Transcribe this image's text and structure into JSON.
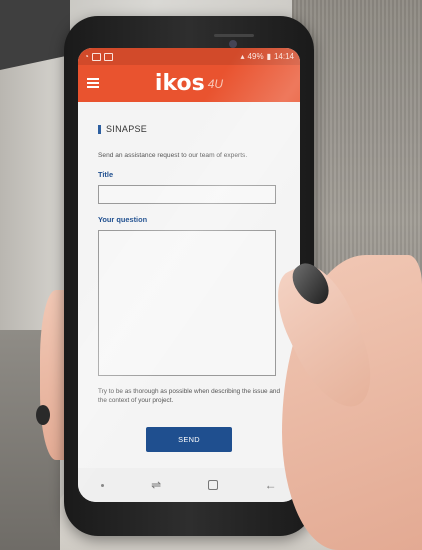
{
  "statusbar": {
    "battery": "49%",
    "time": "14:14"
  },
  "appbar": {
    "logo": "ikos",
    "logo_suffix": "4U"
  },
  "form": {
    "section_title": "SINAPSE",
    "intro": "Send an assistance request to our team of experts.",
    "title_label": "Title",
    "title_value": "",
    "question_label": "Your question",
    "question_value": "",
    "hint": "Try to be as thorough as possible when describing the issue and the context of your project.",
    "send_label": "SEND"
  },
  "navbar": {
    "recent_icon": "recent-apps-icon",
    "home_icon": "home-icon",
    "back_icon": "back-icon"
  },
  "colors": {
    "accent": "#e9532f",
    "primary": "#1f4f8f"
  }
}
